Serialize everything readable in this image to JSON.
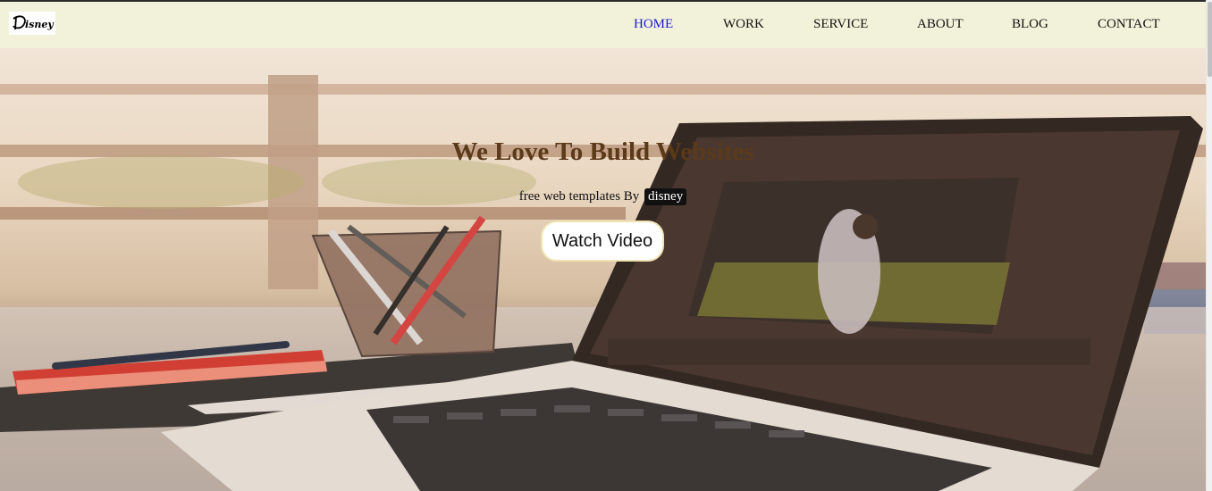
{
  "brand": {
    "logo_text": "Disney"
  },
  "nav": {
    "items": [
      {
        "label": "HOME",
        "active": true
      },
      {
        "label": "WORK",
        "active": false
      },
      {
        "label": "SERVICE",
        "active": false
      },
      {
        "label": "ABOUT",
        "active": false
      },
      {
        "label": "BLOG",
        "active": false
      },
      {
        "label": "CONTACT",
        "active": false
      }
    ],
    "active_color": "#1a1acc"
  },
  "hero": {
    "headline": "We Love To Build Websites",
    "subline_prefix": "free web templates By",
    "subline_brand": "disney",
    "cta_label": "Watch Video",
    "background_image": "laptop-on-desk-photo"
  },
  "colors": {
    "navbar_bg": "#f2f2da",
    "headline": "#5b3a1a"
  }
}
